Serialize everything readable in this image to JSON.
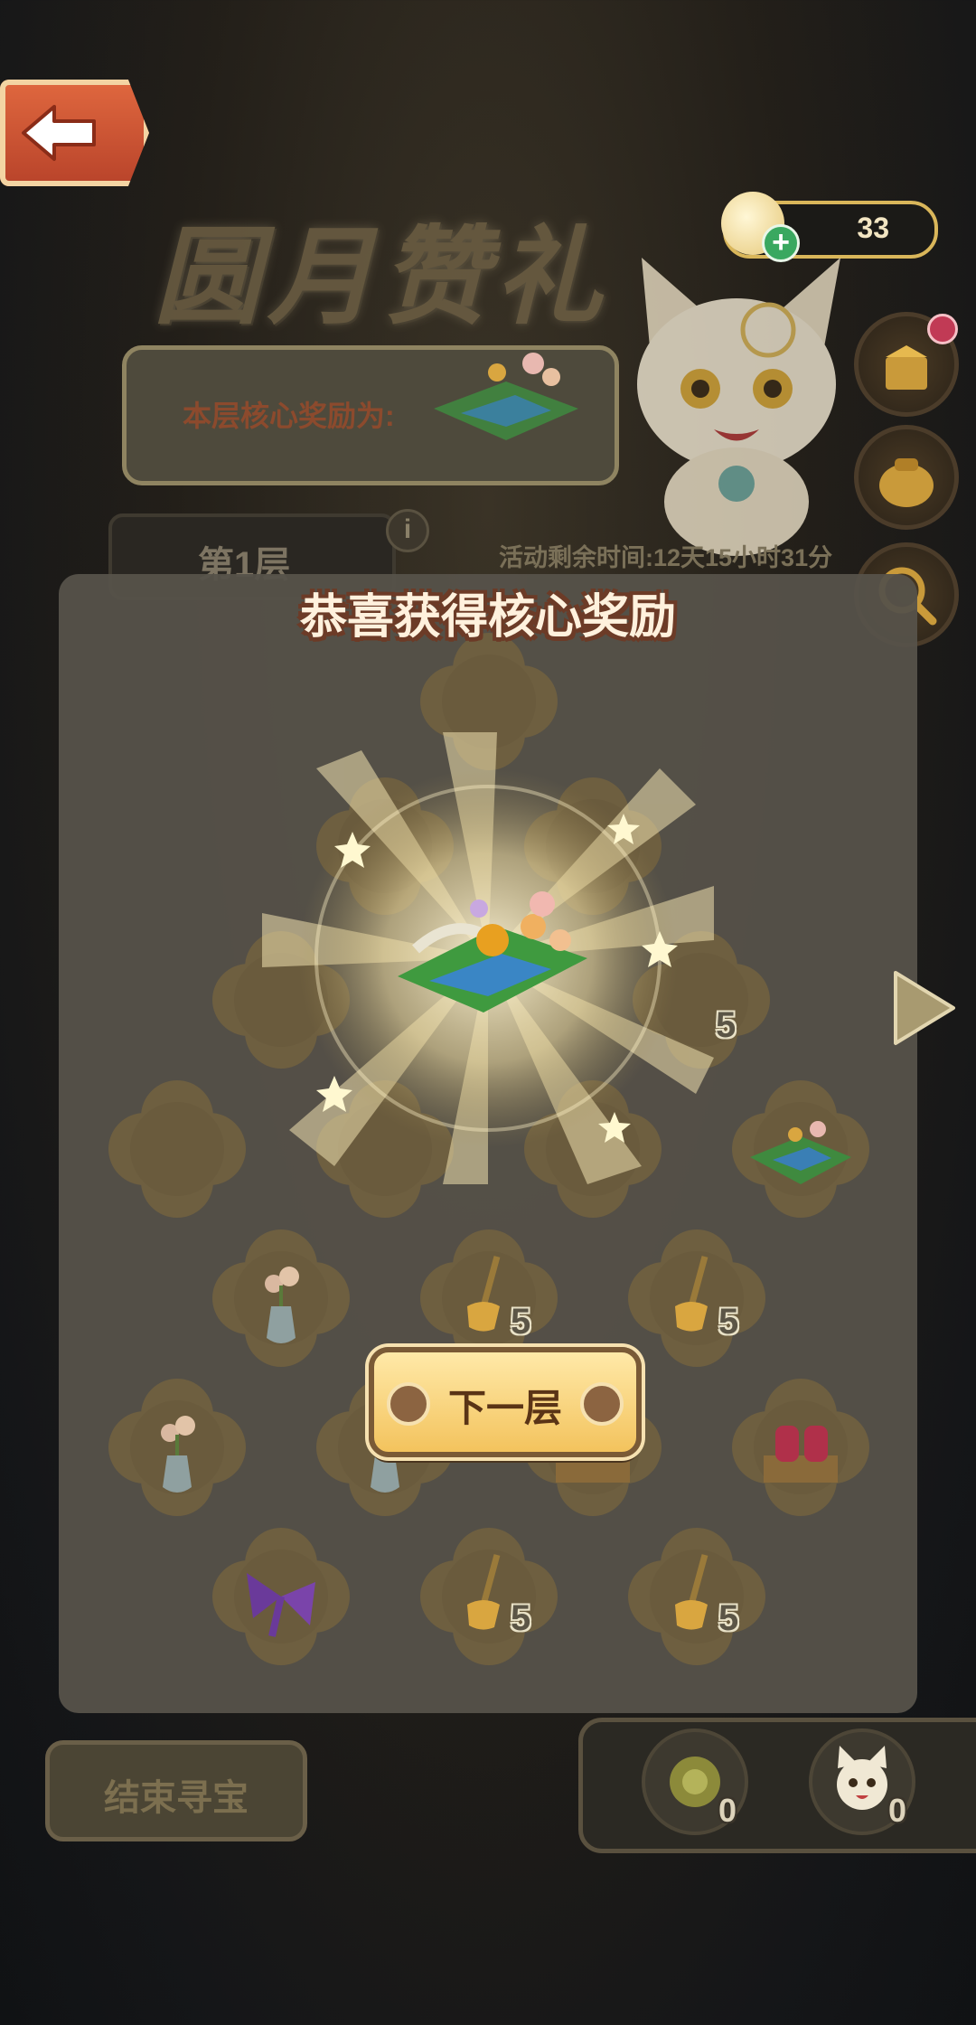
{
  "header": {
    "title": "圆月赞礼",
    "currency_value": "33"
  },
  "reward": {
    "label": "本层核心奖励为:"
  },
  "floor": {
    "label": "第1层",
    "info_symbol": "i"
  },
  "timer_text": "活动剩余时间:12天15小时31分",
  "congrats_text": "恭喜获得核心奖励",
  "grid": {
    "counts": {
      "broom_right_row": "5",
      "broom_r5c2": "5",
      "broom_r5c3": "5",
      "broom_r7c2": "5",
      "broom_r7c3": "5"
    }
  },
  "buttons": {
    "next_floor": "下一层",
    "end_treasure": "结束寻宝"
  },
  "tray": {
    "item1_count": "0",
    "item2_count": "0"
  },
  "colors": {
    "accent_gold": "#f3c35d",
    "back_button": "#d4583a",
    "plus_green": "#3aa860"
  }
}
